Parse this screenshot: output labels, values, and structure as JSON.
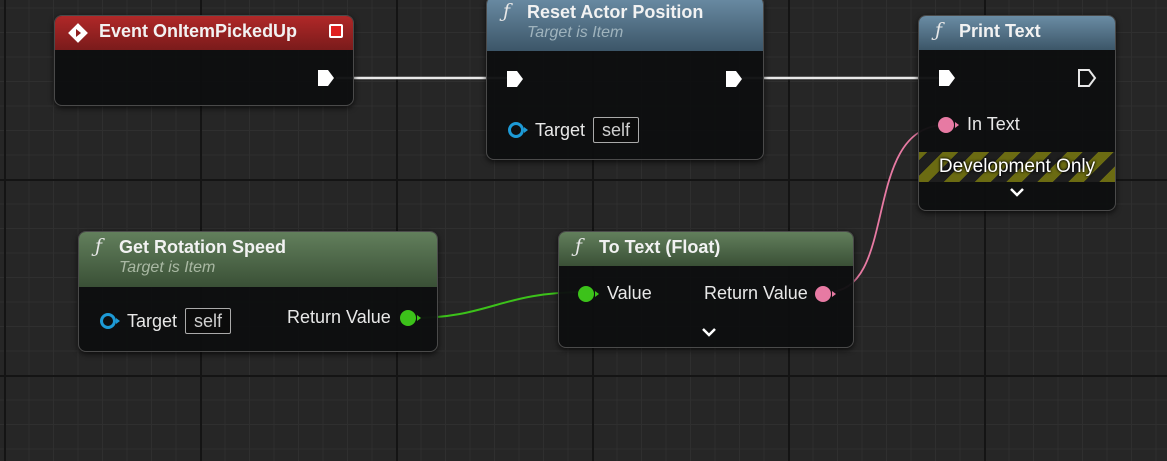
{
  "nodes": {
    "event": {
      "title": "Event OnItemPickedUp"
    },
    "reset": {
      "title": "Reset Actor Position",
      "subtitle": "Target is Item",
      "target_label": "Target",
      "target_value": "self"
    },
    "print": {
      "title": "Print Text",
      "in_text_label": "In Text",
      "dev_label": "Development Only"
    },
    "getrot": {
      "title": "Get Rotation Speed",
      "subtitle": "Target is Item",
      "target_label": "Target",
      "target_value": "self",
      "return_label": "Return Value"
    },
    "totext": {
      "title": "To Text (Float)",
      "value_label": "Value",
      "return_label": "Return Value"
    }
  },
  "icons": {
    "function": "ƒ",
    "chevron": "chevron-down-icon",
    "event": "event-diamond-icon",
    "delegate": "delegate-square-icon",
    "exec": "exec-arrow-icon"
  },
  "colors": {
    "event_header": "#8f1e1e",
    "function_header_blue": "#4e6e84",
    "function_header_green": "#4a6746",
    "exec_wire": "#e8e8e8",
    "float_pin": "#3cc21a",
    "text_pin": "#e77aa3",
    "object_pin": "#1d9ad6",
    "dev_stripe": "#6b6b12"
  }
}
